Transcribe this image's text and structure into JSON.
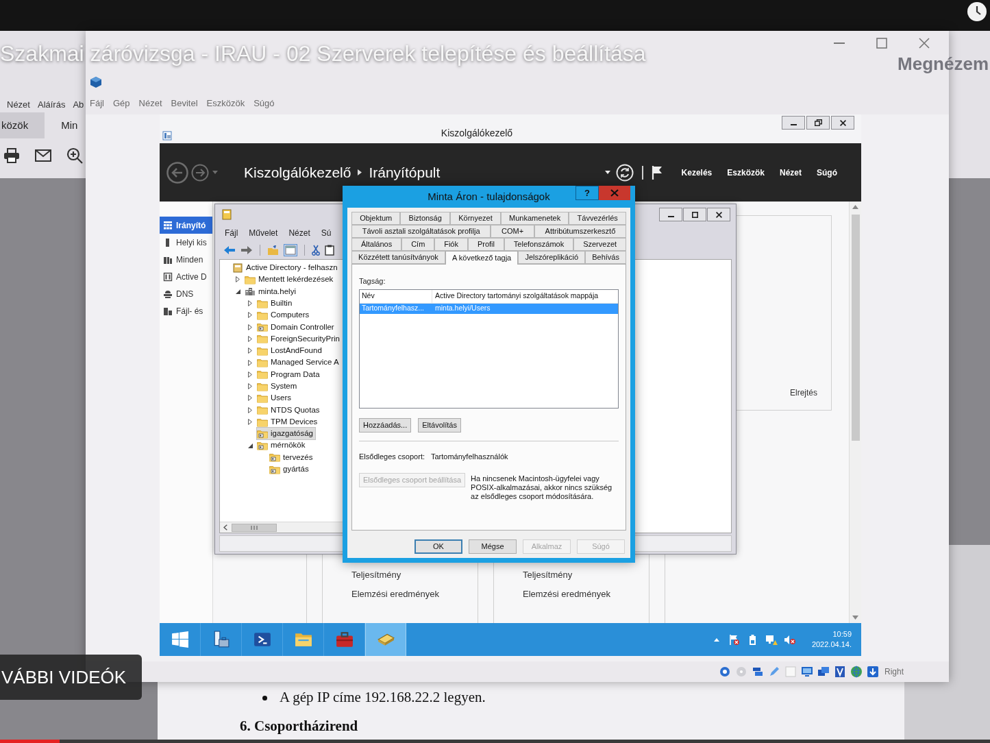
{
  "video_overlay": {
    "title": "Szakmai záróvizsga - IRAU - 02 Szerverek telepítése és beállítása",
    "watch_label": "Megnézem",
    "more_videos": "VÁBBI VIDEÓK",
    "progress": {
      "level": 0.06
    }
  },
  "pdf_viewer": {
    "menu": [
      "Nézet",
      "Aláírás",
      "Ab"
    ],
    "toolbar_tabs": [
      {
        "label": "közök",
        "selected": true
      },
      {
        "label": "Min",
        "selected": false
      }
    ],
    "page_lines": [
      {
        "kind": "bullet",
        "text": "A gép IP címe 192.168.22.2 legyen."
      },
      {
        "kind": "heading",
        "text": "6. Csoportházirend"
      }
    ]
  },
  "virtualbox": {
    "menu": [
      "Fájl",
      "Gép",
      "Nézet",
      "Bevitel",
      "Eszközök",
      "Súgó"
    ],
    "status_host_key": "Right"
  },
  "server_manager": {
    "title": "Kiszolgálókezelő",
    "breadcrumb": [
      "Kiszolgálókezelő",
      "Irányítópult"
    ],
    "menu": [
      "Kezelés",
      "Eszközök",
      "Nézet",
      "Súgó"
    ],
    "sidebar": [
      {
        "kind": "dashboard",
        "label": "Irányító",
        "selected": true
      },
      {
        "kind": "server",
        "label": "Helyi kis",
        "selected": false
      },
      {
        "kind": "servers",
        "label": "Minden",
        "selected": false
      },
      {
        "kind": "ad",
        "label": "Active D",
        "selected": false
      },
      {
        "kind": "dns",
        "label": "DNS",
        "selected": false
      },
      {
        "kind": "files",
        "label": "Fájl- és",
        "selected": false
      }
    ],
    "hide_link": "Elrejtés",
    "tiles": [
      {
        "lines": [
          "Teljesítmény",
          "Elemzési eredmények"
        ]
      },
      {
        "lines": [
          "Teljesítmény",
          "Elemzési eredmények"
        ]
      }
    ]
  },
  "aduc": {
    "menu": [
      "Fájl",
      "Művelet",
      "Nézet",
      "Sú"
    ],
    "tree": [
      {
        "kind": "root",
        "label": "Active Directory - felhaszn",
        "expandable": false,
        "selected": false,
        "children": [
          {
            "kind": "folder",
            "label": "Mentett lekérdezések",
            "expandable": true,
            "expanded": false,
            "selected": false
          },
          {
            "kind": "domain",
            "label": "minta.helyi",
            "expandable": true,
            "expanded": true,
            "selected": false,
            "children": [
              {
                "kind": "folder",
                "label": "Builtin",
                "expandable": true,
                "expanded": false,
                "selected": false
              },
              {
                "kind": "folder",
                "label": "Computers",
                "expandable": true,
                "expanded": false,
                "selected": false
              },
              {
                "kind": "ou",
                "label": "Domain Controller",
                "expandable": true,
                "expanded": false,
                "selected": false
              },
              {
                "kind": "folder",
                "label": "ForeignSecurityPrin",
                "expandable": true,
                "expanded": false,
                "selected": false
              },
              {
                "kind": "folder",
                "label": "LostAndFound",
                "expandable": true,
                "expanded": false,
                "selected": false
              },
              {
                "kind": "folder",
                "label": "Managed Service A",
                "expandable": true,
                "expanded": false,
                "selected": false
              },
              {
                "kind": "folder",
                "label": "Program Data",
                "expandable": true,
                "expanded": false,
                "selected": false
              },
              {
                "kind": "folder",
                "label": "System",
                "expandable": true,
                "expanded": false,
                "selected": false
              },
              {
                "kind": "folder",
                "label": "Users",
                "expandable": true,
                "expanded": false,
                "selected": false
              },
              {
                "kind": "folder",
                "label": "NTDS Quotas",
                "expandable": true,
                "expanded": false,
                "selected": false
              },
              {
                "kind": "folder",
                "label": "TPM Devices",
                "expandable": true,
                "expanded": false,
                "selected": false
              },
              {
                "kind": "ou",
                "label": "igazgatóság",
                "expandable": false,
                "selected": true
              },
              {
                "kind": "ou",
                "label": "mérnökök",
                "expandable": true,
                "expanded": true,
                "selected": false,
                "children": [
                  {
                    "kind": "ou",
                    "label": "tervezés",
                    "expandable": false,
                    "selected": false
                  },
                  {
                    "kind": "ou",
                    "label": "gyártás",
                    "expandable": false,
                    "selected": false
                  }
                ]
              }
            ]
          }
        ]
      }
    ]
  },
  "dialog": {
    "title": "Minta Áron - tulajdonságok",
    "help": "?",
    "tab_rows": [
      [
        {
          "label": "Objektum",
          "selected": false
        },
        {
          "label": "Biztonság",
          "selected": false
        },
        {
          "label": "Környezet",
          "selected": false
        },
        {
          "label": "Munkamenetek",
          "selected": false
        },
        {
          "label": "Távvezérlés",
          "selected": false
        }
      ],
      [
        {
          "label": "Távoli asztali szolgáltatások profilja",
          "selected": false
        },
        {
          "label": "COM+",
          "selected": false
        },
        {
          "label": "Attribútumszerkesztő",
          "selected": false
        }
      ],
      [
        {
          "label": "Általános",
          "selected": false
        },
        {
          "label": "Cím",
          "selected": false
        },
        {
          "label": "Fiók",
          "selected": false
        },
        {
          "label": "Profil",
          "selected": false
        },
        {
          "label": "Telefonszámok",
          "selected": false
        },
        {
          "label": "Szervezet",
          "selected": false
        }
      ],
      [
        {
          "label": "Közzétett tanúsítványok",
          "selected": false
        },
        {
          "label": "A következő tagja",
          "selected": true
        },
        {
          "label": "Jelszóreplikáció",
          "selected": false
        },
        {
          "label": "Behívás",
          "selected": false
        }
      ]
    ],
    "membership_label": "Tagság:",
    "list": {
      "columns": [
        "Név",
        "Active Directory tartományi szolgáltatások mappája"
      ],
      "rows": [
        {
          "cells": [
            "Tartományfelhasz...",
            "minta.helyi/Users"
          ],
          "selected": true
        }
      ]
    },
    "list_buttons": [
      {
        "label": "Hozzáadás...",
        "disabled": false
      },
      {
        "label": "Eltávolítás",
        "disabled": false
      }
    ],
    "primary_group": {
      "label": "Elsődleges csoport:",
      "value": "Tartományfelhasználók"
    },
    "set_primary_button": {
      "label": "Elsődleges csoport beállítása",
      "disabled": true
    },
    "note": "Ha nincsenek Macintosh-ügyfelei vagy POSIX-alkalmazásai, akkor nincs szükség az elsődleges csoport módosítására.",
    "buttons": [
      {
        "label": "OK",
        "disabled": false,
        "default": true
      },
      {
        "label": "Mégse",
        "disabled": false,
        "default": false
      },
      {
        "label": "Alkalmaz",
        "disabled": true,
        "default": false
      },
      {
        "label": "Súgó",
        "disabled": true,
        "default": false
      }
    ]
  },
  "taskbar": {
    "items": [
      {
        "kind": "start",
        "selected": false
      },
      {
        "kind": "server-manager",
        "selected": false
      },
      {
        "kind": "powershell",
        "selected": false
      },
      {
        "kind": "explorer",
        "selected": false
      },
      {
        "kind": "toolbox",
        "selected": false
      },
      {
        "kind": "aduc",
        "selected": true
      }
    ],
    "tray": [
      {
        "kind": "flag"
      },
      {
        "kind": "battery"
      },
      {
        "kind": "network"
      },
      {
        "kind": "speaker"
      }
    ],
    "time": "10:59",
    "date": "2022.04.14."
  }
}
